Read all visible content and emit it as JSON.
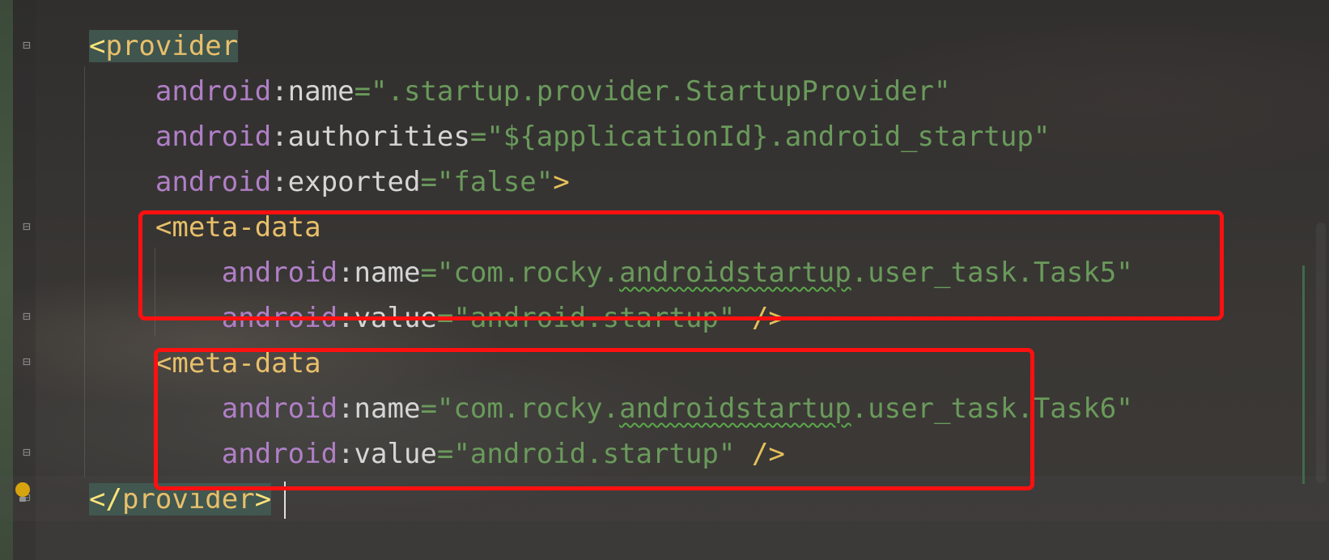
{
  "editor": {
    "lines": [
      {
        "indent": "",
        "tokens": [
          {
            "t": "<",
            "c": "c-bracket-hl tag-hl"
          },
          {
            "t": "provider",
            "c": "c-tag tag-hl"
          }
        ]
      },
      {
        "indent": "    ",
        "tokens": [
          {
            "t": "android",
            "c": "c-ns"
          },
          {
            "t": ":",
            "c": "c-colon"
          },
          {
            "t": "name",
            "c": "c-attr"
          },
          {
            "t": "=",
            "c": "c-eq"
          },
          {
            "t": "\".startup.provider.StartupProvider\"",
            "c": "c-str"
          }
        ]
      },
      {
        "indent": "    ",
        "tokens": [
          {
            "t": "android",
            "c": "c-ns"
          },
          {
            "t": ":",
            "c": "c-colon"
          },
          {
            "t": "authorities",
            "c": "c-attr"
          },
          {
            "t": "=",
            "c": "c-eq"
          },
          {
            "t": "\"${applicationId}.android_startup\"",
            "c": "c-str"
          }
        ]
      },
      {
        "indent": "    ",
        "tokens": [
          {
            "t": "android",
            "c": "c-ns"
          },
          {
            "t": ":",
            "c": "c-colon"
          },
          {
            "t": "exported",
            "c": "c-attr"
          },
          {
            "t": "=",
            "c": "c-eq"
          },
          {
            "t": "\"false\"",
            "c": "c-str"
          },
          {
            "t": ">",
            "c": "c-bracket"
          }
        ]
      },
      {
        "indent": "    ",
        "tokens": [
          {
            "t": "<meta-data",
            "c": "c-tag"
          }
        ]
      },
      {
        "indent": "        ",
        "tokens": [
          {
            "t": "android",
            "c": "c-ns"
          },
          {
            "t": ":",
            "c": "c-colon"
          },
          {
            "t": "name",
            "c": "c-attr"
          },
          {
            "t": "=",
            "c": "c-eq"
          },
          {
            "t": "\"com.rocky.",
            "c": "c-str"
          },
          {
            "t": "androidstartup",
            "c": "c-str squiggle"
          },
          {
            "t": ".user_task.Task5\"",
            "c": "c-str"
          }
        ]
      },
      {
        "indent": "        ",
        "tokens": [
          {
            "t": "android",
            "c": "c-ns"
          },
          {
            "t": ":",
            "c": "c-colon"
          },
          {
            "t": "value",
            "c": "c-attr"
          },
          {
            "t": "=",
            "c": "c-eq"
          },
          {
            "t": "\"android.startup\"",
            "c": "c-str"
          },
          {
            "t": " />",
            "c": "c-bracket"
          }
        ]
      },
      {
        "indent": "    ",
        "tokens": [
          {
            "t": "<meta-data",
            "c": "c-tag"
          }
        ]
      },
      {
        "indent": "        ",
        "tokens": [
          {
            "t": "android",
            "c": "c-ns"
          },
          {
            "t": ":",
            "c": "c-colon"
          },
          {
            "t": "name",
            "c": "c-attr"
          },
          {
            "t": "=",
            "c": "c-eq"
          },
          {
            "t": "\"com.rocky.",
            "c": "c-str"
          },
          {
            "t": "androidstartup",
            "c": "c-str squiggle"
          },
          {
            "t": ".user_task.Task6\"",
            "c": "c-str"
          }
        ]
      },
      {
        "indent": "        ",
        "tokens": [
          {
            "t": "android",
            "c": "c-ns"
          },
          {
            "t": ":",
            "c": "c-colon"
          },
          {
            "t": "value",
            "c": "c-attr"
          },
          {
            "t": "=",
            "c": "c-eq"
          },
          {
            "t": "\"android.startup\"",
            "c": "c-str"
          },
          {
            "t": " />",
            "c": "c-bracket"
          }
        ]
      },
      {
        "indent": "",
        "tokens": [
          {
            "t": "</",
            "c": "c-bracket-hl tag-hl"
          },
          {
            "t": "provider",
            "c": "c-tag tag-hl"
          },
          {
            "t": ">",
            "c": "c-bracket-hl tag-hl"
          }
        ]
      }
    ]
  },
  "gutter": {
    "fold_icons": [
      "fold-start-icon",
      "fold-start-icon",
      "fold-end-icon",
      "fold-start-icon",
      "fold-end-icon",
      "fold-end-icon"
    ],
    "intention_icon": "lightbulb-icon"
  },
  "colors": {
    "highlight_box": "#ff1010",
    "namespace": "#b07fc6",
    "string": "#6a9a5b",
    "tag": "#e8bf6a"
  }
}
